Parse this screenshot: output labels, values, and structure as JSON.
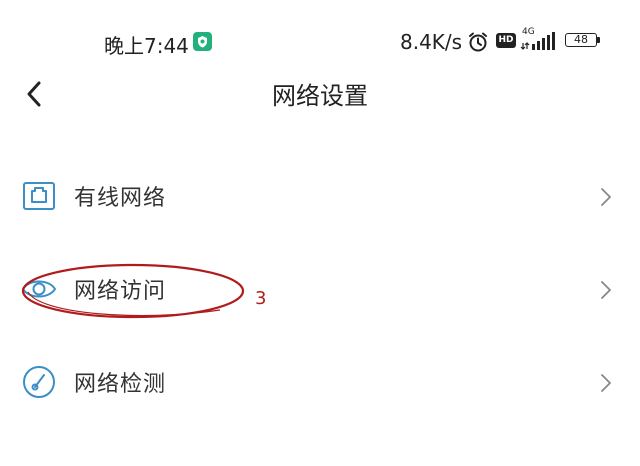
{
  "status_bar": {
    "time": "晚上7:44",
    "net_speed": "8.4K/s",
    "hd_badge": "HD",
    "signal_type": "4G",
    "battery": "48"
  },
  "header": {
    "title": "网络设置"
  },
  "menu": {
    "items": [
      {
        "label": "有线网络",
        "icon": "ethernet-icon"
      },
      {
        "label": "网络访问",
        "icon": "eye-icon"
      },
      {
        "label": "网络检测",
        "icon": "speedometer-icon"
      }
    ]
  },
  "annotation": {
    "number": "3",
    "color": "#b01c1c"
  },
  "colors": {
    "accent": "#3a8fc7",
    "status_badge": "#22b07d",
    "annotation": "#b01c1c"
  }
}
